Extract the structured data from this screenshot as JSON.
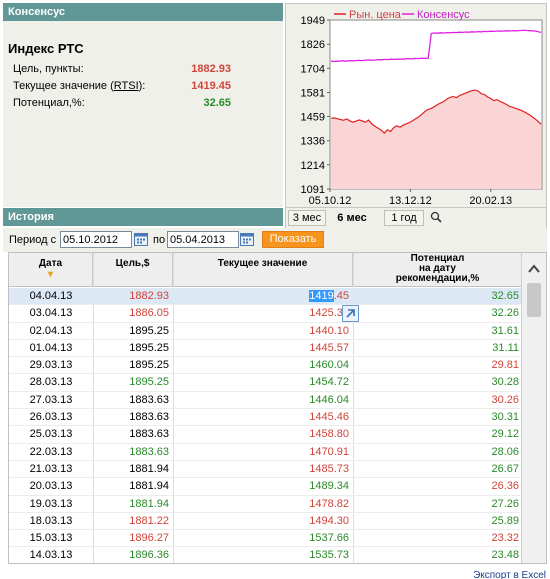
{
  "consensus": {
    "header": "Консенсус",
    "title": "Индекс РТС",
    "metrics": [
      {
        "label": "Цель, пункты:",
        "value": "1882.93"
      },
      {
        "label_prefix": "Текущее значение (",
        "label_link": "RTSI",
        "label_suffix": "):",
        "value": "1419.45"
      },
      {
        "label": "Потенциал,%:",
        "value": "32.65"
      }
    ]
  },
  "chart_data": {
    "type": "line",
    "series": [
      {
        "name": "Рын. цена",
        "color": "#e02020"
      },
      {
        "name": "Консенсус",
        "color": "#e020e0"
      }
    ],
    "y_ticks": [
      "1949",
      "1826",
      "1704",
      "1581",
      "1459",
      "1336",
      "1214",
      "1091"
    ],
    "x_ticks": [
      "05.10.12",
      "13.12.12",
      "20.02.13"
    ],
    "ylim": [
      1091,
      1949
    ],
    "xlim": [
      "05.10.12",
      "05.04.13"
    ],
    "market_price": [
      1450,
      1452,
      1448,
      1444,
      1440,
      1447,
      1437,
      1430,
      1435,
      1442,
      1436,
      1430,
      1441,
      1422,
      1410,
      1400,
      1390,
      1375,
      1392,
      1383,
      1402,
      1412,
      1405,
      1415,
      1422,
      1428,
      1438,
      1448,
      1458,
      1470,
      1485,
      1495,
      1500,
      1510,
      1520,
      1528,
      1535,
      1548,
      1556,
      1560,
      1555,
      1565,
      1572,
      1578,
      1585,
      1590,
      1593,
      1588,
      1575,
      1570,
      1558,
      1550,
      1540,
      1545,
      1535,
      1528,
      1520,
      1510,
      1506,
      1500,
      1494,
      1488,
      1480,
      1470,
      1460,
      1448,
      1435,
      1420
    ],
    "consensus": [
      1740,
      1739,
      1740,
      1741,
      1742,
      1740,
      1743,
      1742,
      1743,
      1744,
      1743,
      1745,
      1746,
      1745,
      1746,
      1748,
      1747,
      1749,
      1748,
      1750,
      1749,
      1750,
      1751,
      1750,
      1752,
      1753,
      1752,
      1754,
      1753,
      1755,
      1754,
      1755,
      1881,
      1883,
      1882,
      1884,
      1883,
      1885,
      1884,
      1886,
      1885,
      1887,
      1886,
      1888,
      1887,
      1889,
      1888,
      1890,
      1889,
      1891,
      1890,
      1892,
      1891,
      1893,
      1892,
      1893,
      1894,
      1893,
      1895,
      1894,
      1895,
      1896,
      1896,
      1895,
      1894,
      1893,
      1890,
      1886
    ]
  },
  "periods": [
    {
      "label": "3 мес"
    },
    {
      "label": "6 мес"
    },
    {
      "label": "1 год"
    }
  ],
  "history": {
    "header": "История",
    "from_label": "Период с",
    "from_value": "05.10.2012",
    "to_label": "по",
    "to_value": "05.04.2013",
    "show_button": "Показать",
    "columns": [
      "Дата",
      "Цель,$",
      "Текущее значение",
      "Потенциал на дату рекомендации,%"
    ],
    "columns_lines": {
      "pot1": "Потенциал",
      "pot2": "на дату",
      "pot3": "рекомендации,%"
    },
    "rows": [
      {
        "date": "04.04.13",
        "target": "1882.93",
        "t": "r",
        "current": "1419.45",
        "c": "r",
        "pot": "32.65",
        "p": "g"
      },
      {
        "date": "03.04.13",
        "target": "1886.05",
        "t": "r",
        "current": "1425.35",
        "c": "r",
        "pot": "32.26",
        "p": "g"
      },
      {
        "date": "02.04.13",
        "target": "1895.25",
        "t": "k",
        "current": "1440.10",
        "c": "r",
        "pot": "31.61",
        "p": "g"
      },
      {
        "date": "01.04.13",
        "target": "1895.25",
        "t": "k",
        "current": "1445.57",
        "c": "r",
        "pot": "31.11",
        "p": "g"
      },
      {
        "date": "29.03.13",
        "target": "1895.25",
        "t": "k",
        "current": "1460.04",
        "c": "g",
        "pot": "29.81",
        "p": "r"
      },
      {
        "date": "28.03.13",
        "target": "1895.25",
        "t": "g",
        "current": "1454.72",
        "c": "g",
        "pot": "30.28",
        "p": "g"
      },
      {
        "date": "27.03.13",
        "target": "1883.63",
        "t": "k",
        "current": "1446.04",
        "c": "g",
        "pot": "30.26",
        "p": "r"
      },
      {
        "date": "26.03.13",
        "target": "1883.63",
        "t": "k",
        "current": "1445.46",
        "c": "r",
        "pot": "30.31",
        "p": "g"
      },
      {
        "date": "25.03.13",
        "target": "1883.63",
        "t": "k",
        "current": "1458.80",
        "c": "r",
        "pot": "29.12",
        "p": "g"
      },
      {
        "date": "22.03.13",
        "target": "1883.63",
        "t": "g",
        "current": "1470.91",
        "c": "r",
        "pot": "28.06",
        "p": "g"
      },
      {
        "date": "21.03.13",
        "target": "1881.94",
        "t": "k",
        "current": "1485.73",
        "c": "r",
        "pot": "26.67",
        "p": "g"
      },
      {
        "date": "20.03.13",
        "target": "1881.94",
        "t": "k",
        "current": "1489.34",
        "c": "g",
        "pot": "26.36",
        "p": "r"
      },
      {
        "date": "19.03.13",
        "target": "1881.94",
        "t": "g",
        "current": "1478.82",
        "c": "r",
        "pot": "27.26",
        "p": "g"
      },
      {
        "date": "18.03.13",
        "target": "1881.22",
        "t": "r",
        "current": "1494.30",
        "c": "r",
        "pot": "25.89",
        "p": "g"
      },
      {
        "date": "15.03.13",
        "target": "1896.27",
        "t": "r",
        "current": "1537.66",
        "c": "g",
        "pot": "23.32",
        "p": "r"
      },
      {
        "date": "14.03.13",
        "target": "1896.36",
        "t": "g",
        "current": "1535.73",
        "c": "g",
        "pot": "23.48",
        "p": "g"
      }
    ],
    "export_label": "Экспорт в Excel"
  },
  "colors": {
    "r": "#d0443a",
    "g": "#2a8a2a",
    "k": "#000000",
    "header": "#5f9896",
    "button": "#f7941d"
  }
}
